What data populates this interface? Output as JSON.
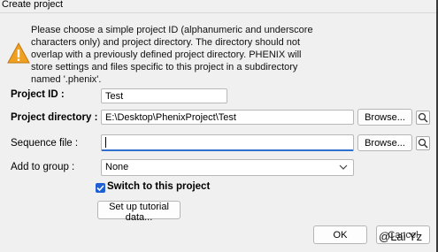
{
  "window": {
    "title": "Create project"
  },
  "message": "Please choose a simple project ID (alphanumeric and underscore characters only) and project directory.  The directory should not overlap with a previously defined project directory.  PHENIX will store settings and files specific to this project in a subdirectory named '.phenix'.",
  "form": {
    "project_id_label": "Project ID :",
    "project_id_value": "Test",
    "project_dir_label": "Project directory :",
    "project_dir_value": "E:\\Desktop\\PhenixProject\\Test",
    "sequence_label": "Sequence file :",
    "sequence_value": "",
    "group_label": "Add to group :",
    "group_selected": "None",
    "browse_label": "Browse...",
    "switch_label": "Switch to this project",
    "switch_checked": true,
    "tutorial_button": "Set up tutorial data..."
  },
  "buttons": {
    "ok": "OK",
    "cancel": "Cancel"
  },
  "watermark": "@Lai Yz",
  "colors": {
    "accent": "#1f5fd6",
    "warning": "#f0a020"
  },
  "icons": [
    "warning-icon",
    "magnifier-icon",
    "chevron-down-icon",
    "checkmark-icon"
  ]
}
